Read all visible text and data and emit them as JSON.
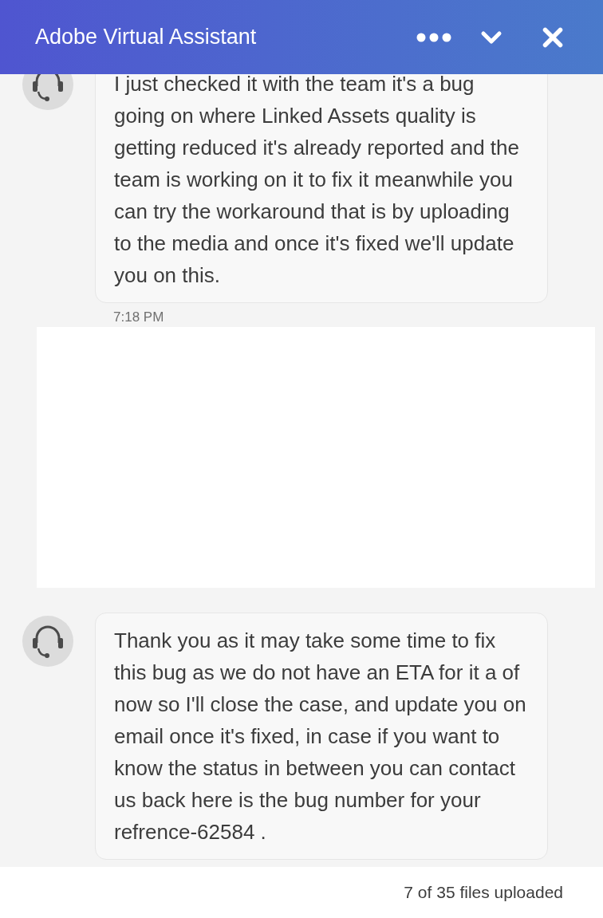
{
  "header": {
    "title": "Adobe Virtual Assistant"
  },
  "messages": [
    {
      "kind": "agent",
      "text": "I just checked it with the team it's a bug going on where Linked Assets quality is getting reduced it's already reported and the team is working on it  to fix it meanwhile you can try the workaround that is by uploading to the media and once it's fixed we'll update you on this.",
      "time": "7:18 PM"
    },
    {
      "kind": "redacted"
    },
    {
      "kind": "agent",
      "text": "Thank you as it may take some time to fix this bug as we do not have an ETA for it a of now so I'll close the case, and update you on email once it's fixed,  in case if you want to know the status in between you can contact us back here is the bug number for your refrence-62584 ."
    }
  ],
  "footer": {
    "status": "7 of 35 files uploaded"
  }
}
